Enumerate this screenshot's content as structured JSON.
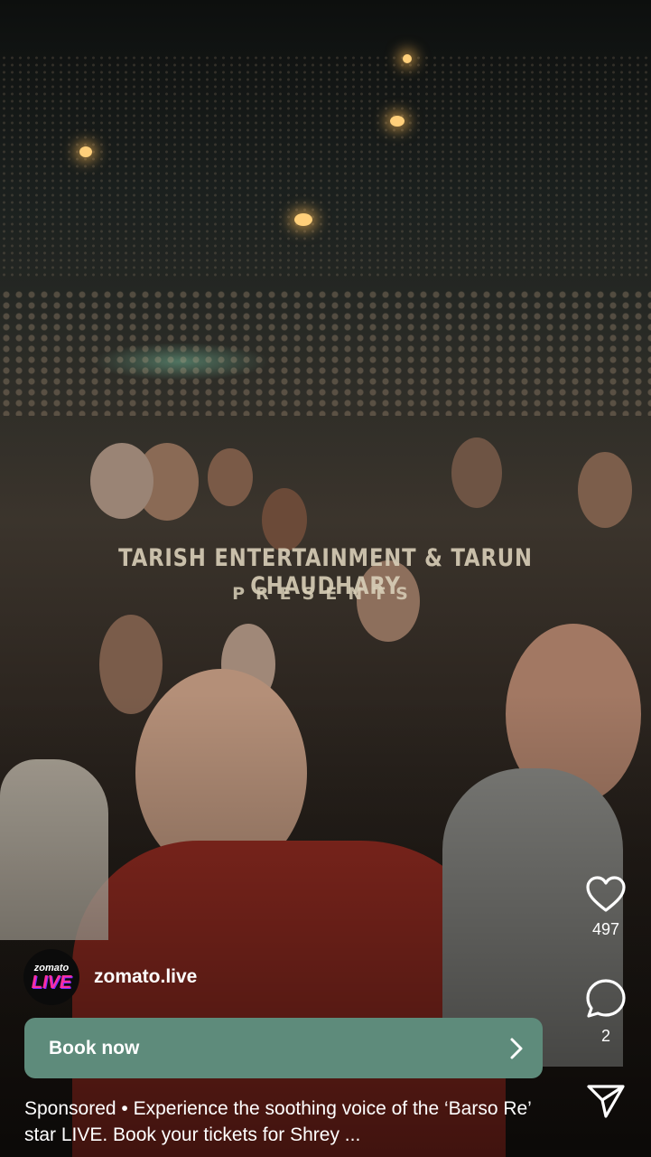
{
  "video": {
    "overlay_title": "TARISH ENTERTAINMENT & TARUN CHAUDHARY",
    "overlay_subtitle": "PRESENTS"
  },
  "actions": {
    "like_icon": "heart-icon",
    "like_count": "497",
    "comment_icon": "comment-bubble-icon",
    "comment_count": "2",
    "share_icon": "paper-plane-icon"
  },
  "account": {
    "avatar_text_top": "zomato",
    "avatar_text_bottom": "LIVE",
    "username": "zomato.live"
  },
  "cta": {
    "label": "Book now",
    "icon": "chevron-right-icon",
    "color": "#5e8b7b"
  },
  "caption": {
    "text": "Sponsored • Experience the soothing voice of the ‘Barso Re’ star LIVE. Book your tickets for Shrey ..."
  }
}
